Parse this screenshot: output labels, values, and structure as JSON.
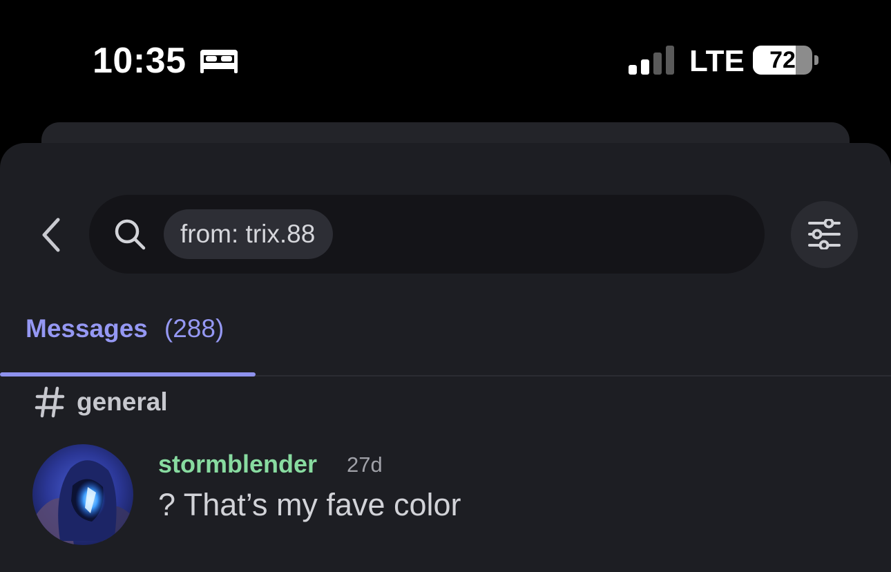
{
  "status_bar": {
    "time": "10:35",
    "focus_icon": "bed-icon",
    "signal_icon": "cellular-signal-icon",
    "signal_bars": 2,
    "signal_bars_total": 4,
    "network": "LTE",
    "battery_level": "72",
    "battery_fraction": 0.72
  },
  "search": {
    "back_icon": "chevron-left-icon",
    "search_icon": "search-icon",
    "filter_chip": "from: trix.88",
    "filter_icon": "filter-sliders-icon"
  },
  "tabs": [
    {
      "label": "Messages",
      "count": "(288)",
      "active": true
    }
  ],
  "results": {
    "channel": {
      "icon": "hash-icon",
      "name": "general"
    },
    "messages": [
      {
        "author": "stormblender",
        "time": "27d",
        "text": "? That’s my fave color",
        "author_color": "#88dba0"
      }
    ]
  },
  "colors": {
    "accent": "#9598f3",
    "background": "#1d1e23",
    "search_bar": "#141418"
  }
}
